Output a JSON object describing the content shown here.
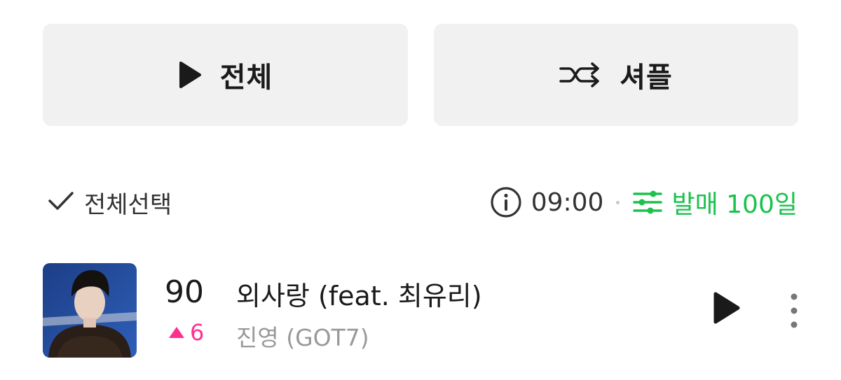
{
  "actions": {
    "play_all_label": "전체",
    "shuffle_label": "셔플"
  },
  "toolbar": {
    "select_all_label": "전체선택",
    "time": "09:00",
    "filter_label": "발매 100일"
  },
  "song": {
    "rank": "90",
    "rank_change": "6",
    "rank_direction": "up",
    "title": "외사랑 (feat. 최유리)",
    "artist": "진영 (GOT7)"
  },
  "icons": {
    "play_all": "play-icon",
    "shuffle": "shuffle-icon",
    "select_all": "check-icon",
    "info": "info-icon",
    "filter": "sliders-icon",
    "rank_up": "triangle-up-icon",
    "row_play": "play-icon",
    "more": "more-vertical-icon"
  },
  "colors": {
    "accent_green": "#1bc24c",
    "rank_up_pink": "#ff2f8f",
    "button_bg": "#f1f1f1",
    "secondary_text": "#999999"
  }
}
